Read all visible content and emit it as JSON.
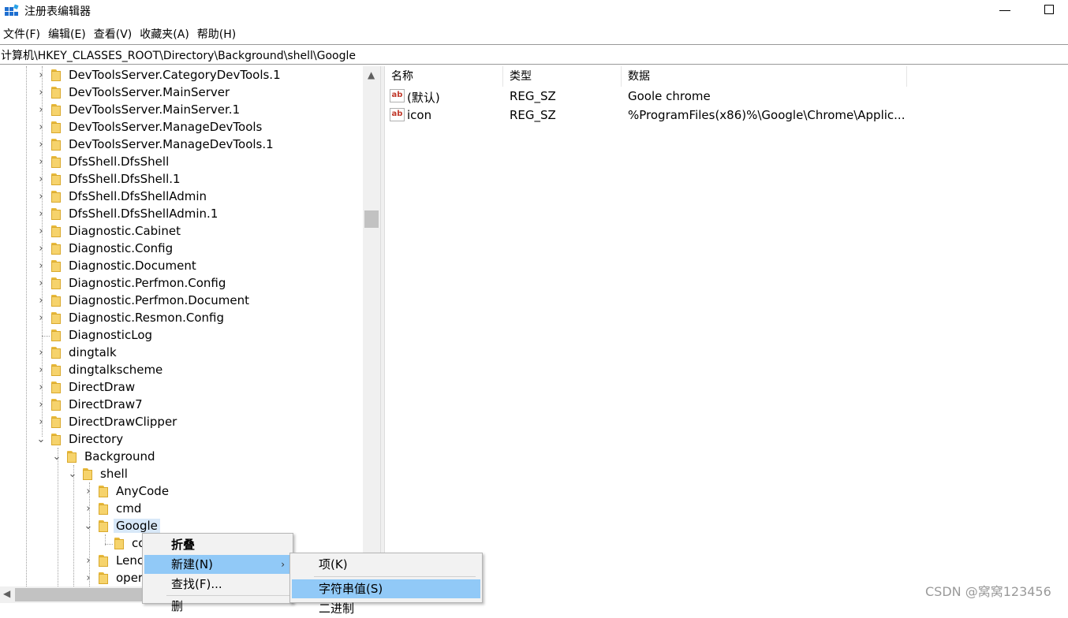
{
  "window": {
    "title": "注册表编辑器",
    "icon": "regedit-icon"
  },
  "menu": [
    "文件(F)",
    "编辑(E)",
    "查看(V)",
    "收藏夹(A)",
    "帮助(H)"
  ],
  "address": "计算机\\HKEY_CLASSES_ROOT\\Directory\\Background\\shell\\Google",
  "tree": [
    {
      "label": "DevToolsServer.CategoryDevTools.1",
      "expander": "›"
    },
    {
      "label": "DevToolsServer.MainServer",
      "expander": "›"
    },
    {
      "label": "DevToolsServer.MainServer.1",
      "expander": "›"
    },
    {
      "label": "DevToolsServer.ManageDevTools",
      "expander": "›"
    },
    {
      "label": "DevToolsServer.ManageDevTools.1",
      "expander": "›"
    },
    {
      "label": "DfsShell.DfsShell",
      "expander": "›"
    },
    {
      "label": "DfsShell.DfsShell.1",
      "expander": "›"
    },
    {
      "label": "DfsShell.DfsShellAdmin",
      "expander": "›"
    },
    {
      "label": "DfsShell.DfsShellAdmin.1",
      "expander": "›"
    },
    {
      "label": "Diagnostic.Cabinet",
      "expander": "›"
    },
    {
      "label": "Diagnostic.Config",
      "expander": "›"
    },
    {
      "label": "Diagnostic.Document",
      "expander": "›"
    },
    {
      "label": "Diagnostic.Perfmon.Config",
      "expander": "›"
    },
    {
      "label": "Diagnostic.Perfmon.Document",
      "expander": "›"
    },
    {
      "label": "Diagnostic.Resmon.Config",
      "expander": "›"
    },
    {
      "label": "DiagnosticLog",
      "expander": ""
    },
    {
      "label": "dingtalk",
      "expander": "›"
    },
    {
      "label": "dingtalkscheme",
      "expander": "›"
    },
    {
      "label": "DirectDraw",
      "expander": "›"
    },
    {
      "label": "DirectDraw7",
      "expander": "›"
    },
    {
      "label": "DirectDrawClipper",
      "expander": "›"
    },
    {
      "label": "Directory",
      "expander": "⌄"
    },
    {
      "label": "Background",
      "expander": "⌄"
    },
    {
      "label": "shell",
      "expander": "⌄"
    },
    {
      "label": "AnyCode",
      "expander": "›"
    },
    {
      "label": "cmd",
      "expander": "›"
    },
    {
      "label": "Google",
      "expander": "⌄"
    },
    {
      "label": "co",
      "expander": ""
    },
    {
      "label": "Lenc",
      "expander": "›"
    },
    {
      "label": "oper",
      "expander": "›"
    }
  ],
  "list": {
    "headers": [
      "名称",
      "类型",
      "数据"
    ],
    "rows": [
      {
        "icon": "ab",
        "name": "(默认)",
        "type": "REG_SZ",
        "data": "Goole chrome"
      },
      {
        "icon": "ab",
        "name": "icon",
        "type": "REG_SZ",
        "data": "%ProgramFiles(x86)%\\Google\\Chrome\\Applic..."
      }
    ]
  },
  "context_menu": {
    "items": [
      "折叠",
      "新建(N)",
      "查找(F)...",
      "删"
    ]
  },
  "submenu": {
    "items": [
      "项(K)",
      "字符串值(S)",
      "二进制"
    ]
  },
  "watermark": "CSDN @窝窝123456",
  "colors": {
    "highlight": "#91c9f7",
    "selected": "#d8e8f8",
    "folder": "#f6d36c"
  }
}
